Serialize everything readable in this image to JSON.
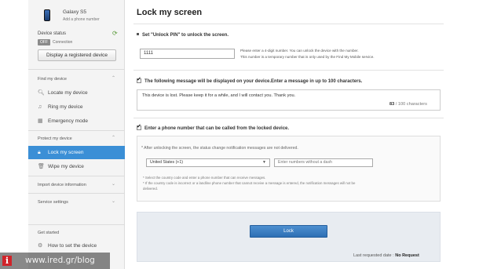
{
  "device": {
    "name": "Galaxy S5",
    "add": "Add a phone number",
    "status_title": "Device status",
    "off_label": "OFF",
    "connection_label": "Connection",
    "display_button": "Display a registered device"
  },
  "sidebar": {
    "find_title": "Find my device",
    "find_items": [
      {
        "label": "Locate my device",
        "icon": "search-icon"
      },
      {
        "label": "Ring my device",
        "icon": "music-note-icon"
      },
      {
        "label": "Emergency mode",
        "icon": "emergency-icon"
      }
    ],
    "protect_title": "Protect my device",
    "protect_items": [
      {
        "label": "Lock my screen",
        "icon": "lock-icon",
        "active": true
      },
      {
        "label": "Wipe my device",
        "icon": "trash-icon"
      }
    ],
    "import_title": "Import device information",
    "service_title": "Service settings",
    "started_title": "Get started",
    "started_item": "How to set the device"
  },
  "main": {
    "title": "Lock my screen",
    "step1": "Set \"Unlock PIN\" to unlock the screen.",
    "pin_value": "1111",
    "pin_note1": "Please enter a 4-digit number. You can unlock the device with the number.",
    "pin_note2": "This number is a temporary number that is only used by the Find My Mobile service.",
    "step2": "The following message will be displayed on your device.Enter a message in up to 100 characters.",
    "message": "This device is lost. Please keep it for a while, and I will contact you. Thank you.",
    "count_current": "83",
    "count_sep": " / ",
    "count_max": "100 characters",
    "step3": "Enter a phone number that can be called from the locked device.",
    "phone_note": "* After unlocking the screen, the status change notification messages are not delivered.",
    "country": "United States (+1)",
    "number_placeholder": "Enter numbers without a dash",
    "fine1": "* Select the country code and enter a phone number that can receive messages.",
    "fine2": "* If the country code is incorrect or a landline phone number that cannot receive a message is entered, the notification messages will not be",
    "fine3": "delivered.",
    "lock_button": "Lock",
    "last_requested_label": "Last requested date",
    "last_requested_sep": " : ",
    "last_requested_value": "No Request"
  },
  "watermark": {
    "logo": "i",
    "text": "www.ired.gr/blog"
  },
  "colors": {
    "accent": "#3b8fd6",
    "button": "#2d6fb4",
    "watermark_red": "#d0242a"
  }
}
